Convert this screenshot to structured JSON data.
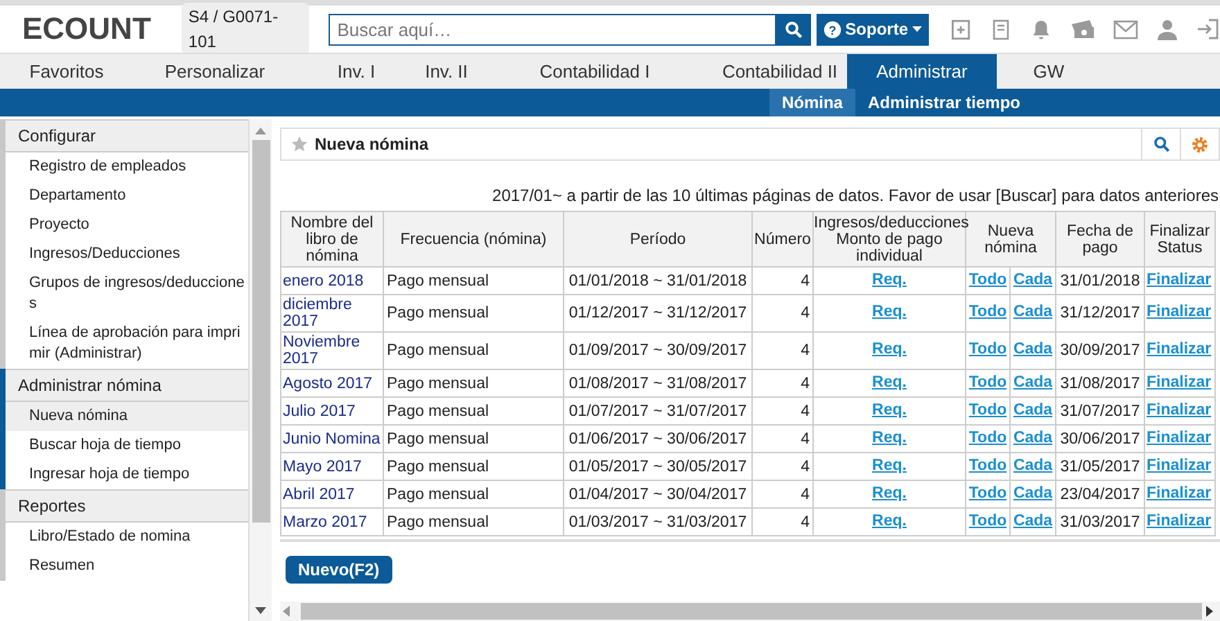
{
  "header": {
    "logo": "ECOUNT",
    "company_code": "S4 / G0071-101",
    "search": {
      "placeholder": "Buscar aquí…"
    },
    "support_icon": "?",
    "support_button": "Soporte"
  },
  "main_tabs": [
    {
      "label": "Favoritos",
      "selected": false
    },
    {
      "label": "Personalizar",
      "selected": false
    },
    {
      "label": "Inv. I",
      "selected": false
    },
    {
      "label": "Inv. II",
      "selected": false
    },
    {
      "label": "Contabilidad I",
      "selected": false
    },
    {
      "label": "Contabilidad II",
      "selected": false
    },
    {
      "label": "Administrar",
      "selected": true
    },
    {
      "label": "GW",
      "selected": false
    }
  ],
  "sub_tabs": [
    {
      "label": "Nómina",
      "selected": true
    },
    {
      "label": "Administrar tiempo",
      "selected": false
    }
  ],
  "sidebar": {
    "sections": [
      {
        "title": "Configurar",
        "active": false,
        "items": [
          {
            "label": "Registro de empleados",
            "selected": false
          },
          {
            "label": "Departamento",
            "selected": false
          },
          {
            "label": "Proyecto",
            "selected": false
          },
          {
            "label": "Ingresos/Deducciones",
            "selected": false
          },
          {
            "label": "Grupos de ingresos/deduccione s",
            "selected": false
          },
          {
            "label": "Línea de aprobación para impri mir (Administrar)",
            "selected": false
          }
        ]
      },
      {
        "title": "Administrar nómina",
        "active": true,
        "items": [
          {
            "label": "Nueva nómina",
            "selected": true
          },
          {
            "label": "Buscar hoja de tiempo",
            "selected": false
          },
          {
            "label": "Ingresar hoja de tiempo",
            "selected": false
          }
        ]
      },
      {
        "title": "Reportes",
        "active": false,
        "items": [
          {
            "label": "Libro/Estado de nomina",
            "selected": false
          },
          {
            "label": "Resumen",
            "selected": false
          }
        ]
      }
    ]
  },
  "panel": {
    "title": "Nueva nómina",
    "notice": "2017/01~ a partir de las 10 últimas páginas de datos. Favor de usar [Buscar] para datos anteriores",
    "table": {
      "columns": [
        "Nombre del libro de nómina",
        "Frecuencia (nómina)",
        "Período",
        "Número",
        "Ingresos/deducciones Monto de pago individual",
        "Nueva nómina",
        "Fecha de pago",
        "Finalizar Status"
      ],
      "rows": [
        {
          "name": "enero 2018",
          "frequency": "Pago mensual",
          "period": "01/01/2018 ~ 31/01/2018",
          "number": "4",
          "amount": "Req.",
          "all": "Todo",
          "each": "Cada",
          "pay_date": "31/01/2018",
          "status": "Finalizar"
        },
        {
          "name": "diciembre 2017",
          "frequency": "Pago mensual",
          "period": "01/12/2017 ~ 31/12/2017",
          "number": "4",
          "amount": "Req.",
          "all": "Todo",
          "each": "Cada",
          "pay_date": "31/12/2017",
          "status": "Finalizar"
        },
        {
          "name": "Noviembre 2017",
          "frequency": "Pago mensual",
          "period": "01/09/2017 ~ 30/09/2017",
          "number": "4",
          "amount": "Req.",
          "all": "Todo",
          "each": "Cada",
          "pay_date": "30/09/2017",
          "status": "Finalizar"
        },
        {
          "name": "Agosto 2017",
          "frequency": "Pago mensual",
          "period": "01/08/2017 ~ 31/08/2017",
          "number": "4",
          "amount": "Req.",
          "all": "Todo",
          "each": "Cada",
          "pay_date": "31/08/2017",
          "status": "Finalizar"
        },
        {
          "name": "Julio 2017",
          "frequency": "Pago mensual",
          "period": "01/07/2017 ~ 31/07/2017",
          "number": "4",
          "amount": "Req.",
          "all": "Todo",
          "each": "Cada",
          "pay_date": "31/07/2017",
          "status": "Finalizar"
        },
        {
          "name": "Junio Nomina",
          "frequency": "Pago mensual",
          "period": "01/06/2017 ~ 30/06/2017",
          "number": "4",
          "amount": "Req.",
          "all": "Todo",
          "each": "Cada",
          "pay_date": "30/06/2017",
          "status": "Finalizar"
        },
        {
          "name": "Mayo 2017",
          "frequency": "Pago mensual",
          "period": "01/05/2017 ~ 30/05/2017",
          "number": "4",
          "amount": "Req.",
          "all": "Todo",
          "each": "Cada",
          "pay_date": "31/05/2017",
          "status": "Finalizar"
        },
        {
          "name": "Abril 2017",
          "frequency": "Pago mensual",
          "period": "01/04/2017 ~ 30/04/2017",
          "number": "4",
          "amount": "Req.",
          "all": "Todo",
          "each": "Cada",
          "pay_date": "23/04/2017",
          "status": "Finalizar"
        },
        {
          "name": "Marzo 2017",
          "frequency": "Pago mensual",
          "period": "01/03/2017 ~ 31/03/2017",
          "number": "4",
          "amount": "Req.",
          "all": "Todo",
          "each": "Cada",
          "pay_date": "31/03/2017",
          "status": "Finalizar"
        }
      ]
    },
    "new_button": "Nuevo(F2)"
  }
}
